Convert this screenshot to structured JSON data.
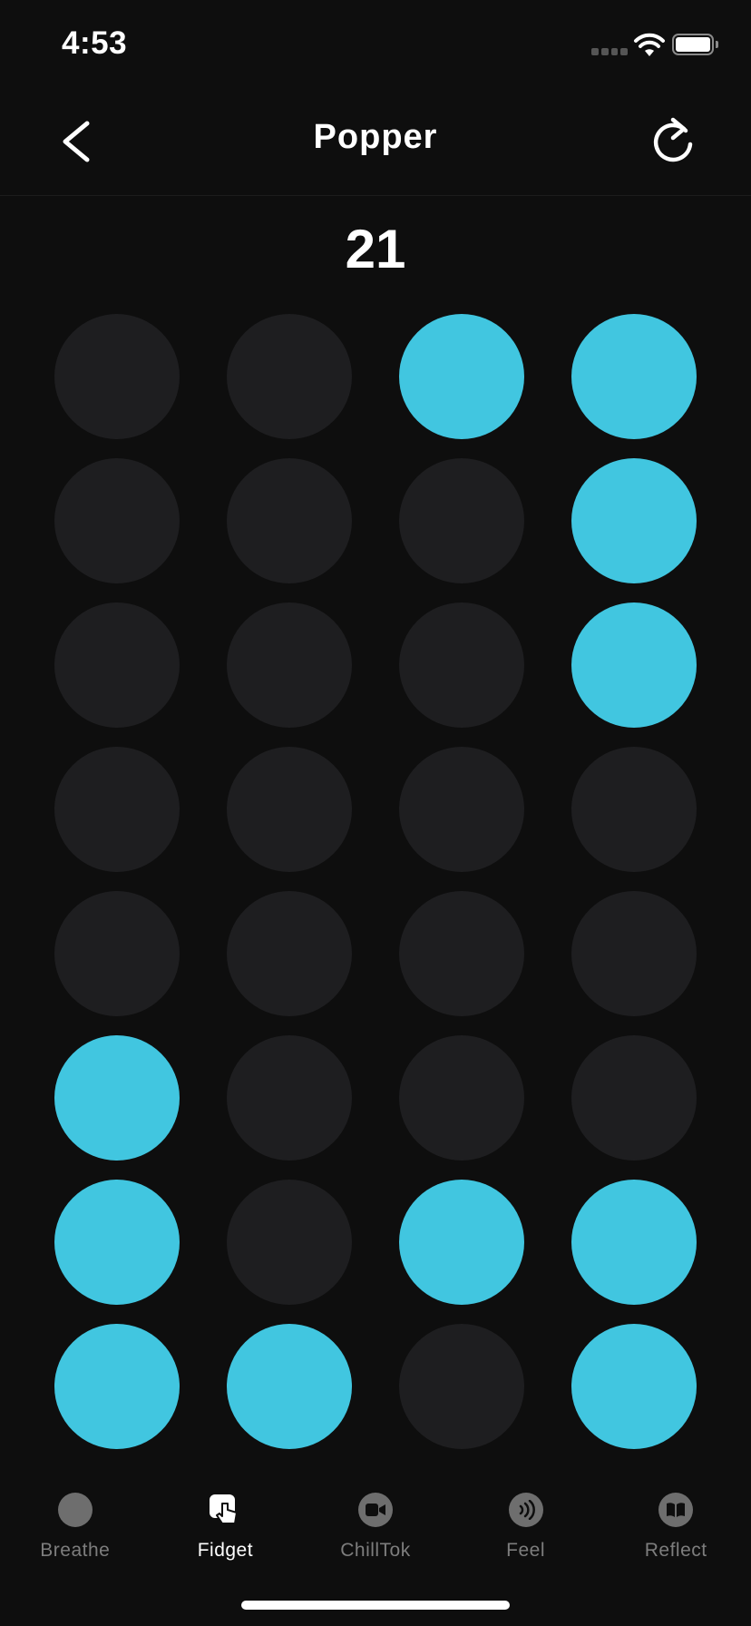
{
  "status_bar": {
    "time": "4:53",
    "icons": [
      "cellular-signal-icon",
      "wifi-icon",
      "battery-icon"
    ]
  },
  "header": {
    "title": "Popper",
    "back_icon": "chevron-left-icon",
    "reset_icon": "refresh-icon"
  },
  "counter": {
    "value": "21"
  },
  "grid": {
    "columns": 4,
    "rows": 8,
    "popped_color": "#41c6e0",
    "unpopped_color": "#1e1e20",
    "cells": [
      [
        false,
        false,
        true,
        true
      ],
      [
        false,
        false,
        false,
        true
      ],
      [
        false,
        false,
        false,
        true
      ],
      [
        false,
        false,
        false,
        false
      ],
      [
        false,
        false,
        false,
        false
      ],
      [
        true,
        false,
        false,
        false
      ],
      [
        true,
        false,
        true,
        true
      ],
      [
        true,
        true,
        false,
        true
      ]
    ]
  },
  "tab_bar": {
    "tabs": [
      {
        "label": "Breathe",
        "icon": "circle-icon",
        "active": false
      },
      {
        "label": "Fidget",
        "icon": "hand-pointer-icon",
        "active": true
      },
      {
        "label": "ChillTok",
        "icon": "video-camera-icon",
        "active": false
      },
      {
        "label": "Feel",
        "icon": "sound-waves-icon",
        "active": false
      },
      {
        "label": "Reflect",
        "icon": "open-book-icon",
        "active": false
      }
    ]
  }
}
